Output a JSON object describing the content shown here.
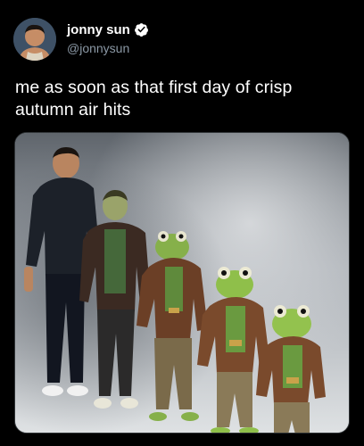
{
  "author": {
    "display_name": "jonny sun",
    "handle": "@jonnysun",
    "verified": true,
    "avatar": "profile-photo"
  },
  "tweet": {
    "text": "me as soon as that first day of crisp autumn air hits"
  },
  "media": {
    "description_icon": "meme-image",
    "colors": {
      "sky_dark": "#6f757c",
      "sky_light": "#d9dcdf",
      "frog_green": "#8fbf4a",
      "jacket_brown": "#6b3f26"
    }
  },
  "colors": {
    "background": "#000000",
    "text": "#ffffff",
    "secondary_text": "#8b98a5",
    "verified_badge": "#ffffff"
  }
}
